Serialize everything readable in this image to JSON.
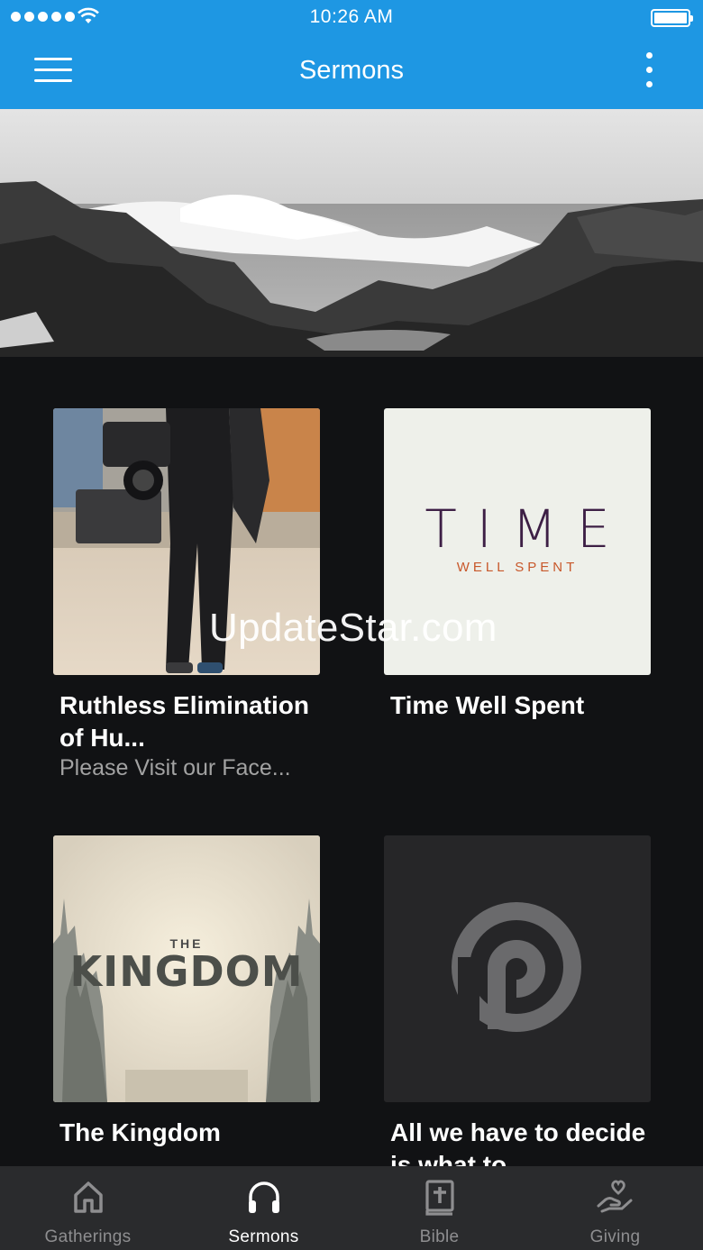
{
  "status_bar": {
    "time": "10:26 AM"
  },
  "header": {
    "title": "Sermons"
  },
  "sermons": [
    {
      "title": "Ruthless Elimination of Hu...",
      "subtitle": "Please Visit our Face..."
    },
    {
      "title": "Time Well Spent",
      "art_title": "TIME",
      "art_subtitle": "WELL SPENT"
    },
    {
      "title": "The Kingdom",
      "art_the": "THE",
      "art_title": "KINGDOM"
    },
    {
      "title": "All we have to decide is what to"
    }
  ],
  "watermark": "UpdateStar.com",
  "tabs": [
    {
      "label": "Gatherings",
      "icon": "home-icon",
      "active": false
    },
    {
      "label": "Sermons",
      "icon": "headphones-icon",
      "active": true
    },
    {
      "label": "Bible",
      "icon": "bible-icon",
      "active": false
    },
    {
      "label": "Giving",
      "icon": "giving-heart-hand-icon",
      "active": false
    }
  ],
  "colors": {
    "header_bg": "#1e97e3",
    "content_bg": "#111214",
    "tabbar_bg": "#2a2b2d",
    "tab_active": "#ffffff",
    "tab_inactive": "#8e8e90",
    "time_purple": "#3d1f45",
    "time_orange": "#c8582b"
  }
}
